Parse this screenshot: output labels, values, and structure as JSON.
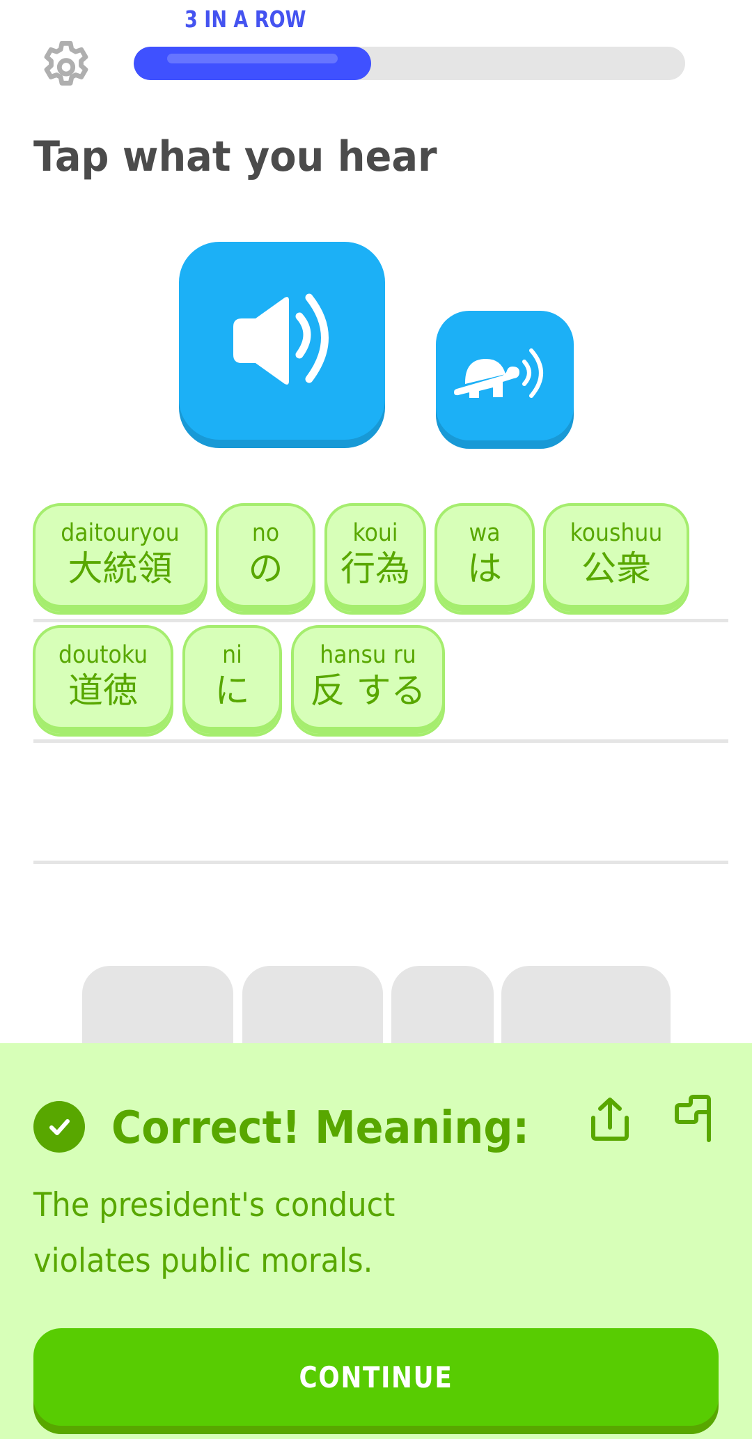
{
  "header": {
    "streak_label": "3 IN A ROW",
    "progress_fraction": 0.43,
    "settings_icon": "gear-icon"
  },
  "challenge": {
    "title": "Tap what you hear",
    "audio_button_icon": "speaker-icon",
    "slow_audio_button_icon": "turtle-speaker-icon"
  },
  "answer": {
    "tiles": [
      {
        "romaji": "daitouryou",
        "text": "大統領"
      },
      {
        "romaji": "no",
        "text": "の"
      },
      {
        "romaji": "koui",
        "text": "行為"
      },
      {
        "romaji": "wa",
        "text": "は"
      },
      {
        "romaji": "koushuu",
        "text": "公衆"
      },
      {
        "romaji": "doutoku",
        "text": "道徳"
      },
      {
        "romaji": "ni",
        "text": "に"
      },
      {
        "romaji": "hansu ru",
        "text": "反 する"
      }
    ]
  },
  "word_bank": {
    "used_slots": 4
  },
  "feedback": {
    "status_icon": "check-circle-icon",
    "title": "Correct! Meaning:",
    "meaning": "The president's conduct violates public morals.",
    "share_icon": "share-icon",
    "report_icon": "flag-icon",
    "continue_label": "CONTINUE"
  },
  "colors": {
    "progress": "#3f51ff",
    "audio": "#1cb0f6",
    "correct_bg": "#d7ffb8",
    "correct_text": "#58a700",
    "continue_button": "#58cc02"
  }
}
